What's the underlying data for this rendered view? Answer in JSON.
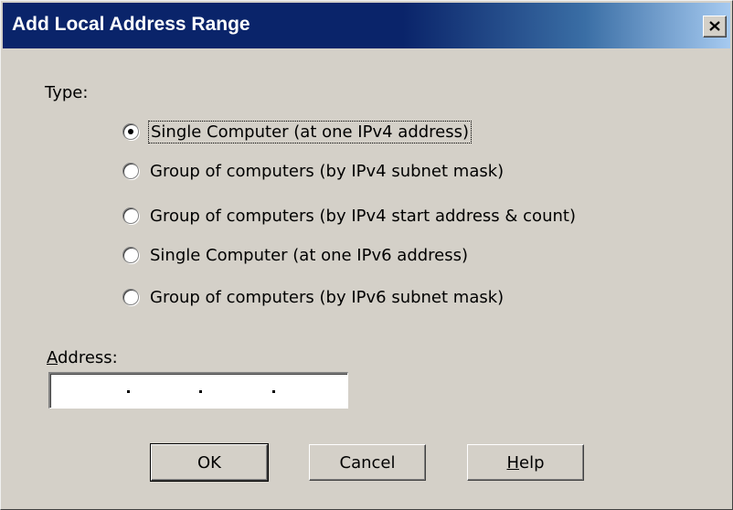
{
  "window": {
    "title": "Add Local Address Range"
  },
  "type_section": {
    "label": "Type:",
    "options": [
      {
        "label": "Single Computer (at one IPv4 address)",
        "checked": true
      },
      {
        "label": "Group of computers (by IPv4 subnet mask)",
        "checked": false
      },
      {
        "label": "Group of computers (by IPv4 start address & count)",
        "checked": false
      },
      {
        "label": "Single Computer (at one IPv6 address)",
        "checked": false
      },
      {
        "label": "Group of computers (by IPv6 subnet mask)",
        "checked": false
      }
    ]
  },
  "address": {
    "label_mnemonic": "A",
    "label_rest": "ddress:",
    "value": ""
  },
  "buttons": {
    "ok": "OK",
    "cancel": "Cancel",
    "help_mnemonic": "H",
    "help_rest": "elp"
  },
  "icons": {
    "close": "close-icon"
  }
}
